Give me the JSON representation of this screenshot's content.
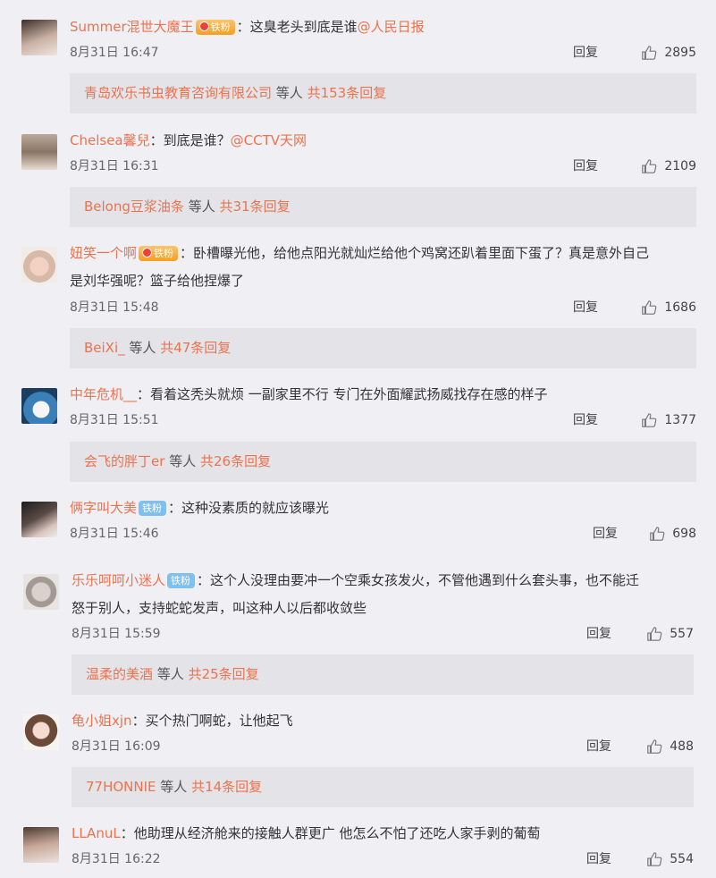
{
  "reply_label": "回复",
  "replies_suffix_label": "等人",
  "comments": [
    {
      "username": "Summer混世大魔王",
      "badge": "铁粉",
      "text": "：这臭老头到底是谁",
      "mention": "@人民日报",
      "time": "8月31日 16:47",
      "likes": "2895",
      "reply_user": "青岛欢乐书虫教育咨询有限公司",
      "reply_total": "共153条回复"
    },
    {
      "username": "Chelsea馨兒",
      "text": "：到底是谁？",
      "mention": "@CCTV天网",
      "time": "8月31日 16:31",
      "likes": "2109",
      "reply_user": "Belong豆浆油条",
      "reply_total": "共31条回复"
    },
    {
      "username": "妞笑一个啊",
      "badge": "铁粉",
      "text": "：卧槽曝光他，给他点阳光就灿烂给他个鸡窝还趴着里面下蛋了？真是意外自己",
      "text2": "是刘华强呢？篮子给他捏爆了",
      "time": "8月31日 15:48",
      "likes": "1686",
      "reply_user": "BeiXi_",
      "reply_total": "共47条回复"
    },
    {
      "username": "中年危机__",
      "text": "：看着这秃头就烦 一副家里不行 专门在外面耀武扬威找存在感的样子",
      "time": "8月31日 15:51",
      "likes": "1377",
      "reply_user": "会飞的胖丁er",
      "reply_total": "共26条回复"
    },
    {
      "username": "俩字叫大美",
      "badge": "铁粉",
      "text": "：这种没素质的就应该曝光",
      "time": "8月31日 15:46",
      "likes": "698"
    },
    {
      "username": "乐乐呵呵小迷人",
      "badge": "铁粉",
      "text": "：这个人没理由要冲一个空乘女孩发火，不管他遇到什么套头事，也不能迁",
      "text2": "怒于别人，支持蛇蛇发声，叫这种人以后都收敛些",
      "time": "8月31日 15:59",
      "likes": "557",
      "reply_user": "温柔的美酒",
      "reply_total": "共25条回复"
    },
    {
      "username": "龟小姐xjn",
      "text": "：买个热门啊蛇，让他起飞",
      "time": "8月31日 16:09",
      "likes": "488",
      "reply_user": "77HONNIE",
      "reply_total": "共14条回复"
    },
    {
      "username": "LLAnuL",
      "text": "：他助理从经济舱来的接触人群更广 他怎么不怕了还吃人家手剥的葡萄",
      "time": "8月31日 16:22",
      "likes": "554"
    }
  ]
}
